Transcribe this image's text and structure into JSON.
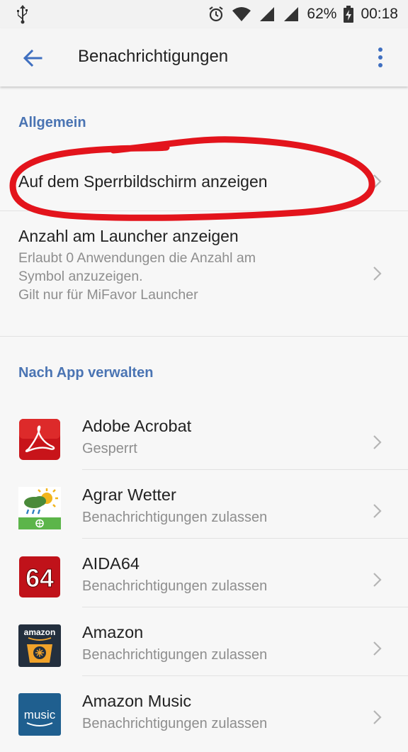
{
  "status_bar": {
    "battery_percent": "62%",
    "time": "00:18",
    "icons": [
      "usb-icon",
      "alarm-icon",
      "wifi-icon",
      "signal-icon",
      "signal-icon",
      "battery-charging-icon"
    ]
  },
  "app_bar": {
    "title": "Benachrichtigungen",
    "back_icon": "arrow-left-icon",
    "menu_icon": "more-vert-icon"
  },
  "general": {
    "header": "Allgemein",
    "lockscreen": {
      "title": "Auf dem Sperrbildschirm anzeigen"
    },
    "launcher_count": {
      "title": "Anzahl am Launcher  anzeigen",
      "line1": "Erlaubt 0 Anwendungen die Anzahl am",
      "line2": "Symbol anzuzeigen.",
      "line3": "Gilt nur für MiFavor Launcher"
    }
  },
  "apps_section": {
    "header": "Nach App verwalten",
    "items": [
      {
        "name": "Adobe Acrobat",
        "status": "Gesperrt",
        "icon": "adobe-acrobat-icon"
      },
      {
        "name": "Agrar Wetter",
        "status": "Benachrichtigungen zulassen",
        "icon": "agrar-wetter-icon"
      },
      {
        "name": "AIDA64",
        "status": "Benachrichtigungen zulassen",
        "icon": "aida64-icon",
        "icon_text": "64"
      },
      {
        "name": "Amazon",
        "status": "Benachrichtigungen zulassen",
        "icon": "amazon-icon",
        "icon_text": "amazon"
      },
      {
        "name": "Amazon Music",
        "status": "Benachrichtigungen zulassen",
        "icon": "amazon-music-icon",
        "icon_text": "music"
      }
    ]
  },
  "colors": {
    "accent": "#4a74b3",
    "annotation": "#e3141c",
    "subtitle": "#8e8e8e"
  }
}
